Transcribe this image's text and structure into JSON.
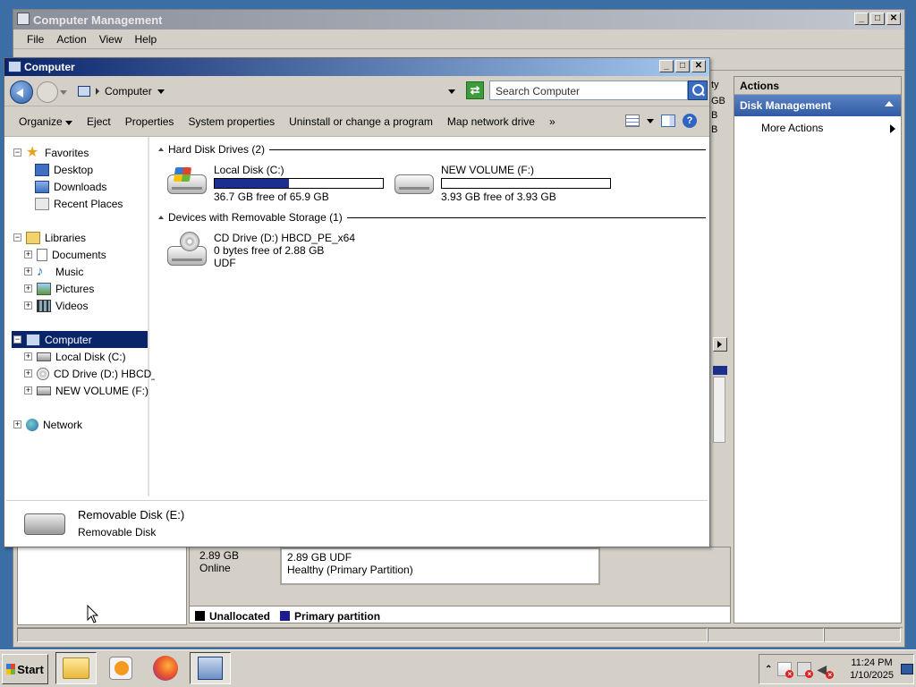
{
  "back_window": {
    "title": "Computer Management",
    "menu": [
      "File",
      "Action",
      "View",
      "Help"
    ],
    "actions_header": "Actions",
    "actions_section": "Disk Management",
    "more_actions": "More Actions",
    "right_cut_text": [
      "ty",
      "GB",
      "B",
      "B"
    ],
    "disk_info": [
      "2.89 GB",
      "Online"
    ],
    "partition": [
      "2.89 GB UDF",
      "Healthy (Primary Partition)"
    ],
    "legend": [
      {
        "label": "Unallocated",
        "color": "#000000"
      },
      {
        "label": "Primary partition",
        "color": "#1c1c8f"
      }
    ]
  },
  "explorer": {
    "title": "Computer",
    "address": "Computer",
    "search_placeholder": "Search Computer",
    "commands": [
      "Organize",
      "Eject",
      "Properties",
      "System properties",
      "Uninstall or change a program",
      "Map network drive",
      "»"
    ],
    "tree": {
      "favorites": "Favorites",
      "desktop": "Desktop",
      "downloads": "Downloads",
      "recent": "Recent Places",
      "libraries": "Libraries",
      "documents": "Documents",
      "music": "Music",
      "pictures": "Pictures",
      "videos": "Videos",
      "computer": "Computer",
      "local_disk": "Local Disk (C:)",
      "cd_drive": "CD Drive (D:) HBCD_P",
      "new_volume": "NEW VOLUME (F:)",
      "network": "Network"
    },
    "groups": {
      "hard_disks": "Hard Disk Drives (2)",
      "removable": "Devices with Removable Storage (1)"
    },
    "drives": {
      "c": {
        "name": "Local Disk (C:)",
        "free": "36.7 GB free of 65.9 GB",
        "used_fraction": 0.443
      },
      "f": {
        "name": "NEW VOLUME (F:)",
        "free": "3.93 GB free of 3.93 GB",
        "used_fraction": 0.0
      },
      "d": {
        "name": "CD Drive (D:) HBCD_PE_x64",
        "free": "0 bytes free of 2.88 GB",
        "fs": "UDF"
      }
    },
    "details": {
      "title": "Removable Disk (E:)",
      "subtitle": "Removable Disk"
    }
  },
  "taskbar": {
    "start": "Start",
    "time": "11:24 PM",
    "date": "1/10/2025"
  },
  "colors": {
    "selection": "#0a246a",
    "bar_fill": "#1c2f8f",
    "actions_accent": "#2f5aa3"
  }
}
